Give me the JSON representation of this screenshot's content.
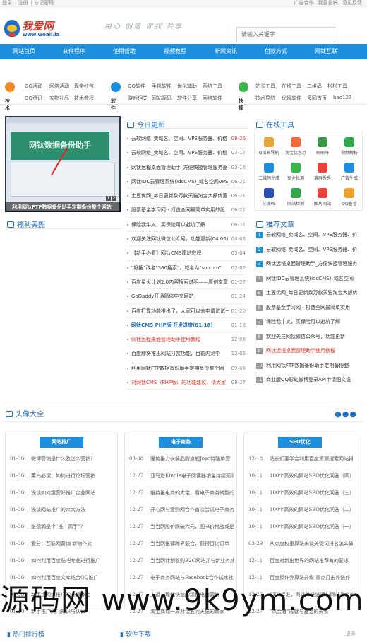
{
  "topbar": {
    "left": [
      "登录",
      "注册",
      "忘记密码"
    ],
    "right": [
      "广告合作",
      "我要投稿",
      "意见反馈"
    ]
  },
  "header": {
    "logo_text": "我爱网",
    "logo_url": "www.woaii.la",
    "slogan": "用心 创造 你我 共享",
    "search_placeholder": "请输入关键字"
  },
  "nav": [
    "网站首页",
    "软件程序",
    "使用帮助",
    "视频教程",
    "新闻资讯",
    "付款方式",
    "网钛互联"
  ],
  "categories": [
    {
      "name": "技术",
      "color": "#f08a24",
      "links": [
        "QQ活动",
        "网络活动",
        "现金红包",
        "QQ资讯",
        "实物礼品",
        "技术教程"
      ]
    },
    {
      "name": "软件",
      "color": "#1e8fdc",
      "links": [
        "QQ软件",
        "手机软件",
        "优化辅助",
        "系统工具",
        "游戏相关",
        "网站源码",
        "软件分享",
        "网络软件"
      ]
    },
    {
      "name": "快捷",
      "color": "#3ab54a",
      "links": [
        "站长工具",
        "在线工具",
        "二维码",
        "松松工具",
        "技术导航",
        "优媛软件",
        "多网首页",
        "hao123"
      ]
    }
  ],
  "slide": {
    "caption": "利用网钛FTP数据备份助手定期备份整个网站",
    "pages": [
      "1",
      "2"
    ],
    "banner": "网钛数据备份助手"
  },
  "sections": {
    "updates": "今日更新",
    "tools": "在线工具",
    "welfare": "福利美图",
    "recommend": "推荐文章",
    "avatars": "头像大全",
    "hot": "热门排行榜",
    "download": "软件下载",
    "more": "更多"
  },
  "updates": [
    {
      "title": "云软网络_卖域名、空间、VPS服务器、价格",
      "date": "08-26",
      "hot": true
    },
    {
      "title": "云软网络_卖域名、空间、VPS服务器、价格",
      "date": "03-17",
      "hot": false
    },
    {
      "title": "网钛远程桌面管理助手_方便快捷管理服务器",
      "date": "03-16",
      "hot": false
    },
    {
      "title": "网钛IDC云管理系统(idcCMS)_域名空间VPS",
      "date": "06-21",
      "hot": false
    },
    {
      "title": "土豆优网_每日更新数万款天猫淘宝大额优惠",
      "date": "06-21",
      "hot": false
    },
    {
      "title": "股票基金学习网 - 打造全网最简单实用的股",
      "date": "06-21",
      "hot": false
    },
    {
      "title": "保险我牛叉，买保险可以避坑了解",
      "date": "06-21",
      "hot": false
    },
    {
      "title": "欢迎关注网钛微信公众号，功能更新(04.06)",
      "date": "04-06",
      "hot": false
    },
    {
      "title": "【新手必看】网钛CMS建站教程",
      "date": "03-04",
      "hot": false
    },
    {
      "title": "\"好搜\"改名\"360搜索\"，域名为\"so.com\"",
      "date": "02-02",
      "hot": false
    },
    {
      "title": "百度星火计划2.0内容搜索说明——原创文章",
      "date": "01-27",
      "hot": false
    },
    {
      "title": "GoDaddy开通简体中文网站",
      "date": "01-24",
      "hot": false
    },
    {
      "title": "百度打算功能推出了，大家可以去申请试试~",
      "date": "01-20",
      "hot": false
    },
    {
      "title": "网钛CMS PHP版 开发进度(01.18)",
      "date": "01-18",
      "hot": false,
      "blue": true
    },
    {
      "title": "网钛远程桌面管理助手使用教程",
      "date": "12-06",
      "hot": false,
      "red": true
    },
    {
      "title": "百度即将推出网站打赏功能，目前内测中",
      "date": "12-05",
      "hot": false
    },
    {
      "title": "利用网钛FTP数据备份助手定期备份整个网",
      "date": "09-08",
      "hot": false
    },
    {
      "title": "对网钛CMS（PHP版）的功能建议，请大家",
      "date": "08-27",
      "hot": false,
      "red": true
    }
  ],
  "tools": [
    {
      "name": "Q域名导航",
      "color": "#e8a43a"
    },
    {
      "name": "淘宝优惠券",
      "color": "#f06a3a"
    },
    {
      "name": "刷刷呀",
      "color": "#3a9a4a"
    },
    {
      "name": "视频解析",
      "color": "#2ea84a"
    },
    {
      "name": "二维码生成",
      "color": "#1e8fdc"
    },
    {
      "name": "安全检测",
      "color": "#3ab54a"
    },
    {
      "name": "滚屏秀秀",
      "color": "#e8443a"
    },
    {
      "name": "广告生成",
      "color": "#1e8fdc"
    },
    {
      "name": "在线PS",
      "color": "#2a4fb5"
    },
    {
      "name": "网站检测",
      "color": "#2ea84a"
    },
    {
      "name": "图片网站",
      "color": "#e8443a"
    },
    {
      "name": "QQ查看",
      "color": "#f0a02a"
    }
  ],
  "recommend": [
    "云软网络_卖域名、空间、VPS服务器、价",
    "云软网络_卖域名、空间、VPS服务器、价",
    "网钛远程桌面管理助手_方便快捷管理服务",
    "网钛IDC云管理系统(idcCMS)_域名空间",
    "土豆优网_每日更新数万款天猫淘宝大额优",
    "股票基金学习网 - 打造全网最简单实用",
    "保险我牛叉，买保险可以避坑了解",
    "欢迎关注网钛微信公众号，功能更新",
    "网钛远程桌面管理助手使用教程",
    "利用网钛FTP数据备份助手定期备份整",
    "商业版QQ彩虹微博登录API申请图文说"
  ],
  "columns": [
    {
      "title": "网站推广",
      "rows": [
        {
          "d": "01-30",
          "t": "微博营销是什么及怎么营销？"
        },
        {
          "d": "01-30",
          "t": "莱鸟必读：如何进行论坛营销"
        },
        {
          "d": "01-30",
          "t": "浅谈如何运营好推广企业网站"
        },
        {
          "d": "01-30",
          "t": "浅谈网站推广的六大方法"
        },
        {
          "d": "01-30",
          "t": "张德润是个\"推广高手\"？"
        },
        {
          "d": "01-30",
          "t": "爱分：互联网营销 新物作文"
        },
        {
          "d": "01-30",
          "t": "如何利用百度贴吧专业进行推广"
        },
        {
          "d": "01-30",
          "t": "如何利用百度文库结合QQ推广"
        },
        {
          "d": "01-30",
          "t": "新手学网络推广的心得体会"
        },
        {
          "d": "01-30",
          "t": "新手推广入门知识与认识"
        }
      ]
    },
    {
      "title": "电子商务",
      "rows": [
        {
          "d": "03-08",
          "t": "强势推力安装品牌旗舰Joyo特强势营"
        },
        {
          "d": "12-27",
          "t": "亚马逊Kindle电子阅读器销量持续预测60%"
        },
        {
          "d": "12-27",
          "t": "维持推电商的大佬，看电子商务转型的"
        },
        {
          "d": "12-27",
          "t": "开心网与爱购网合作首次尝试电子商务"
        },
        {
          "d": "12-27",
          "t": "当当网股价跌破六元，图书价格战或是"
        },
        {
          "d": "12-27",
          "t": "当当网推荐跨界联合，获得百亿订单"
        },
        {
          "d": "12-27",
          "t": "当当网计划收购B2C网站并与新业务线"
        },
        {
          "d": "12-27",
          "t": "电子商务网站与Facebook合作试水社交"
        },
        {
          "d": "12-27",
          "t": "主逛，现代快速的现代电商营销"
        },
        {
          "d": "12-27",
          "t": "淘宝商城一周对话五问天猫的商家"
        }
      ]
    },
    {
      "title": "SEO优化",
      "rows": [
        {
          "d": "12-18",
          "t": "站长们要学会利用百度资源搜索网站排"
        },
        {
          "d": "10-11",
          "t": "100个高效的网站SEO优化问答（四）"
        },
        {
          "d": "10-11",
          "t": "100个高效的网站SEO优化问答（三）"
        },
        {
          "d": "10-11",
          "t": "100个高效的网站SEO优化问答（二）"
        },
        {
          "d": "10-11",
          "t": "100个高效的网站SEO优化问答（一）"
        },
        {
          "d": "03-29",
          "t": "从点度权重算法来谈关键词排名怎么做"
        },
        {
          "d": "12-11",
          "t": "百度对新出世界的网站推荐有的要求"
        },
        {
          "d": "12-11",
          "t": "百度反作弊算法升级 重点打击外链作"
        },
        {
          "d": "12-27",
          "t": "SEO标准，网站外链链接与网站排名的"
        },
        {
          "d": "12-27",
          "t": "\"点金者\"成就与基金的关系"
        }
      ]
    }
  ],
  "watermark": "源码网 www.9k9ym.com"
}
